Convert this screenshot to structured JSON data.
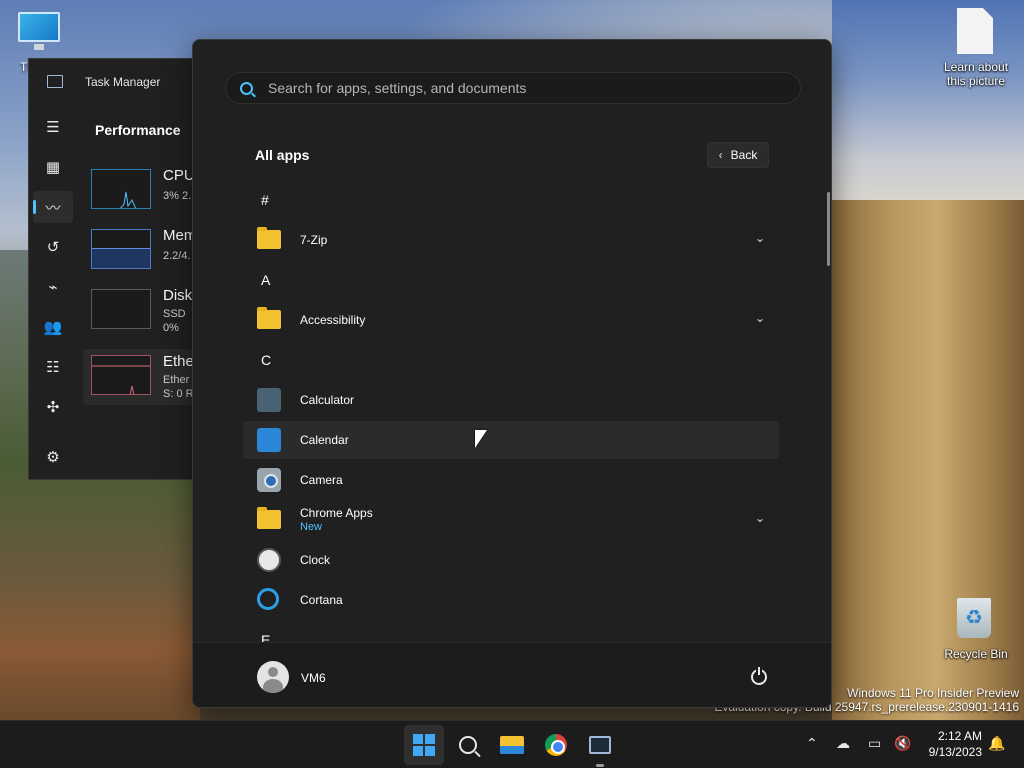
{
  "desktop": {
    "icons": [
      {
        "label": "This PC",
        "icon": "monitor-icon"
      },
      {
        "label": "Learn about this picture",
        "icon": "document-icon"
      },
      {
        "label": "Recycle Bin",
        "icon": "recycle-bin-icon"
      }
    ],
    "watermark": {
      "line1": "Windows 11 Pro Insider Preview",
      "line2": "Evaluation copy. Build 25947.rs_prerelease.230901-1416"
    }
  },
  "task_manager": {
    "title": "Task Manager",
    "heading": "Performance",
    "cards": [
      {
        "title": "CPU",
        "line1": "3% 2.",
        "line2": ""
      },
      {
        "title": "Mem",
        "line1": "2.2/4.",
        "line2": ""
      },
      {
        "title": "Disk",
        "line1": "SSD",
        "line2": "0%"
      },
      {
        "title": "Ethe",
        "line1": "Ether",
        "line2": "S: 0 R"
      }
    ],
    "accent": "#4cc2ff"
  },
  "start_menu": {
    "search_placeholder": "Search for apps, settings, and documents",
    "all_apps_title": "All apps",
    "back_label": "Back",
    "sections": [
      {
        "letter": "#"
      },
      {
        "letter": "A"
      },
      {
        "letter": "C"
      },
      {
        "letter": "E"
      }
    ],
    "apps": [
      {
        "label": "7-Zip",
        "type": "folder",
        "expandable": true
      },
      {
        "label": "Accessibility",
        "type": "folder",
        "expandable": true
      },
      {
        "label": "Calculator",
        "type": "calculator"
      },
      {
        "label": "Calendar",
        "type": "calendar"
      },
      {
        "label": "Camera",
        "type": "camera"
      },
      {
        "label": "Chrome Apps",
        "sub": "New",
        "type": "folder",
        "expandable": true
      },
      {
        "label": "Clock",
        "type": "clock"
      },
      {
        "label": "Cortana",
        "type": "cortana"
      }
    ],
    "user_name": "VM6"
  },
  "taskbar": {
    "time": "2:12 AM",
    "date": "9/13/2023",
    "accent": "#3fa9f5"
  }
}
